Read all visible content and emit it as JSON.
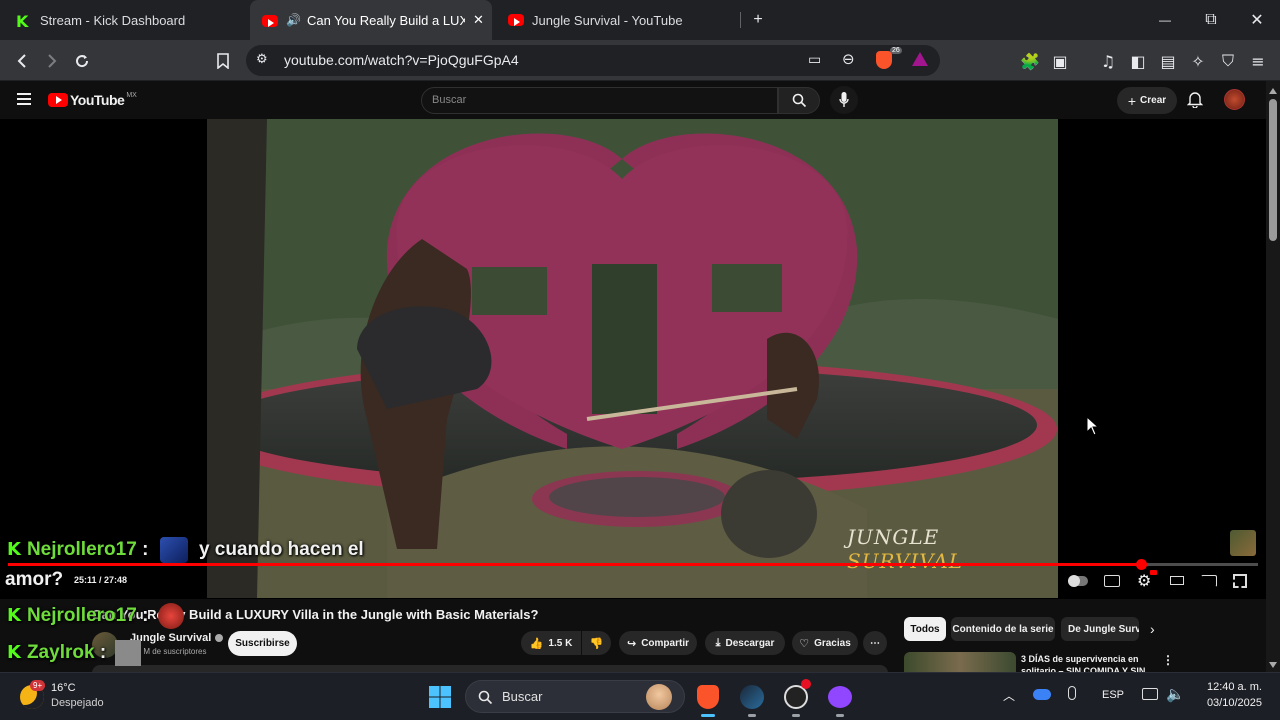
{
  "tabs": [
    {
      "label": "Stream - Kick Dashboard",
      "icon": "kick-icon"
    },
    {
      "label": "Can You Really Build a LUXUR",
      "icon": "youtube-icon",
      "audio": true
    },
    {
      "label": "Jungle Survival - YouTube",
      "icon": "youtube-icon"
    }
  ],
  "window": {
    "minimize": "—",
    "maximize": "⧉",
    "close": "✕",
    "new_tab": "+"
  },
  "toolbar": {
    "url": "youtube.com/watch?v=PjoQguFGpA4",
    "brave_badge": "26"
  },
  "youtube": {
    "logo": "YouTube",
    "region": "MX",
    "search_placeholder": "Buscar",
    "create_label": "Crear"
  },
  "video": {
    "watermark_a": "JUNGLE",
    "watermark_b": "SURVIVAL",
    "time": "25:11 / 27:48",
    "progress": 0.906
  },
  "below": {
    "title": "Can You Really Build a LUXURY Villa in the Jungle with Basic Materials?",
    "channel": "Jungle Survival",
    "subs": "1.3 M de suscriptores",
    "subscribe": "Suscribirse",
    "likes": "1.5 K",
    "share": "Compartir",
    "download": "Descargar",
    "thanks": "Gracias",
    "more": "⋯"
  },
  "chips": [
    {
      "label": "Todos",
      "active": true
    },
    {
      "label": "Contenido de la serie",
      "active": false
    },
    {
      "label": "De Jungle Survi",
      "active": false
    }
  ],
  "recommendation": {
    "title_line1": "3 DÍAS de supervivencia en",
    "title_line2": "solitario – SIN COMIDA Y SIN"
  },
  "chat": [
    {
      "user": "Nejrollero17",
      "sep": ":",
      "message": "y cuando hacen el",
      "message2": "amor?"
    },
    {
      "user": "Nejrollero17",
      "sep": ":",
      "message": ""
    },
    {
      "user": "Zaylrok",
      "sep": ":",
      "message": ""
    }
  ],
  "taskbar": {
    "weather_temp": "16°C",
    "weather_desc": "Despejado",
    "weather_badge": "9+",
    "search": "Buscar",
    "lang": "ESP",
    "time": "12:40 a. m.",
    "date": "03/10/2025"
  }
}
